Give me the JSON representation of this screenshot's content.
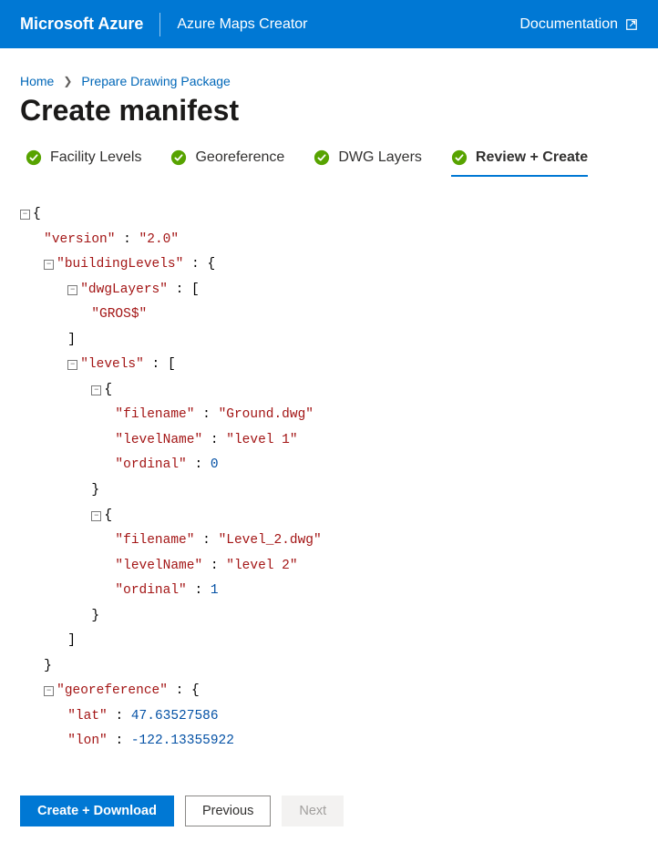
{
  "topbar": {
    "brand": "Microsoft Azure",
    "product": "Azure Maps Creator",
    "doc_link": "Documentation"
  },
  "breadcrumb": {
    "home": "Home",
    "current": "Prepare Drawing Package"
  },
  "title": "Create manifest",
  "tabs": [
    {
      "label": "Facility Levels",
      "active": false
    },
    {
      "label": "Georeference",
      "active": false
    },
    {
      "label": "DWG Layers",
      "active": false
    },
    {
      "label": "Review + Create",
      "active": true
    }
  ],
  "manifest": {
    "version": "2.0",
    "buildingLevels": {
      "dwgLayers": [
        "GROS$"
      ],
      "levels": [
        {
          "filename": "Ground.dwg",
          "levelName": "level 1",
          "ordinal": 0
        },
        {
          "filename": "Level_2.dwg",
          "levelName": "level 2",
          "ordinal": 1
        }
      ]
    },
    "georeference": {
      "lat": 47.63527586,
      "lon": -122.13355922
    }
  },
  "json_keys": {
    "version": "version",
    "buildingLevels": "buildingLevels",
    "dwgLayers": "dwgLayers",
    "levels": "levels",
    "filename": "filename",
    "levelName": "levelName",
    "ordinal": "ordinal",
    "georeference": "georeference",
    "lat": "lat",
    "lon": "lon"
  },
  "footer": {
    "create": "Create + Download",
    "previous": "Previous",
    "next": "Next"
  }
}
